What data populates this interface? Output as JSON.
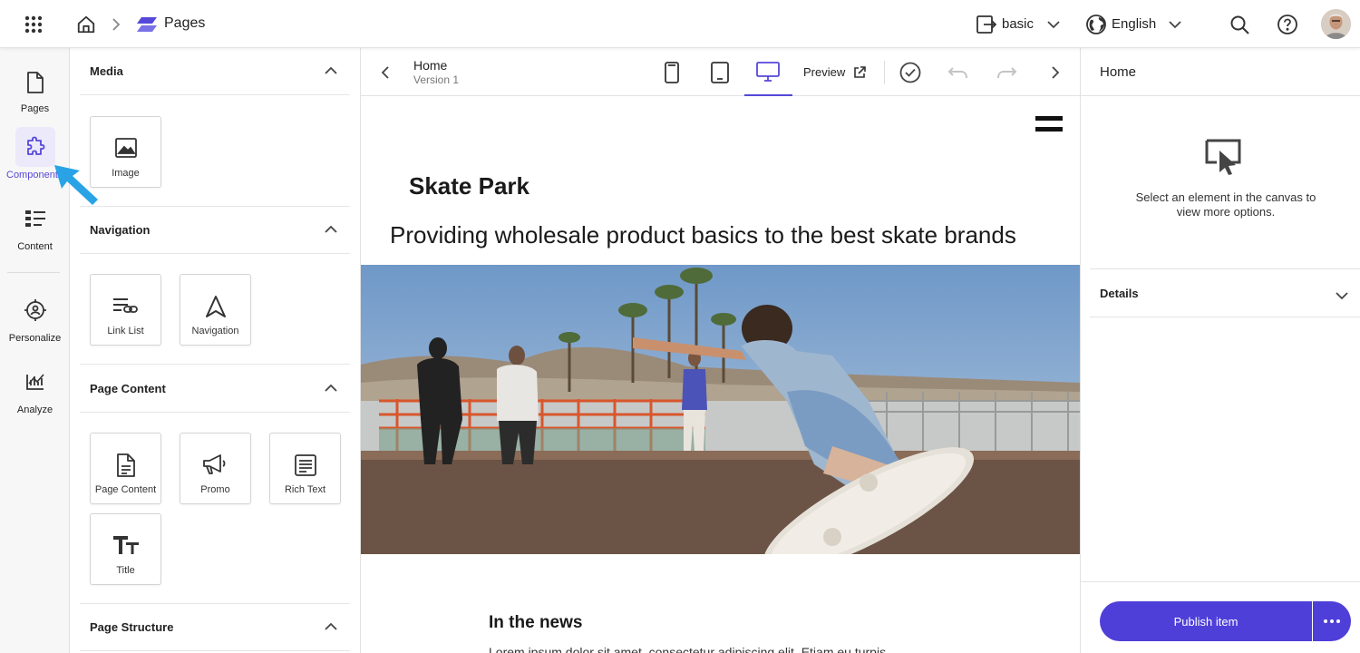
{
  "colors": {
    "accent": "#5548d9",
    "publish": "#4f3fd9",
    "arrow": "#29a3e6"
  },
  "topbar": {
    "apps_icon": "grid-icon",
    "home_icon": "home-icon",
    "breadcrumb_current": "Pages",
    "site_selector": "basic",
    "language_selector": "English",
    "search_icon": "search-icon",
    "help_icon": "help-icon"
  },
  "rail": {
    "items": [
      {
        "label": "Pages",
        "icon": "page-icon"
      },
      {
        "label": "Components",
        "icon": "puzzle-icon"
      },
      {
        "label": "Content",
        "icon": "content-list-icon"
      },
      {
        "label": "Personalize",
        "icon": "target-icon"
      },
      {
        "label": "Analyze",
        "icon": "analytics-icon"
      }
    ],
    "active": "Components"
  },
  "components": {
    "sections": [
      {
        "title": "Media",
        "tiles": [
          {
            "label": "Image",
            "icon": "image-icon"
          }
        ]
      },
      {
        "title": "Navigation",
        "tiles": [
          {
            "label": "Link List",
            "icon": "link-list-icon"
          },
          {
            "label": "Navigation",
            "icon": "navigation-icon"
          }
        ]
      },
      {
        "title": "Page Content",
        "tiles": [
          {
            "label": "Page Content",
            "icon": "document-icon"
          },
          {
            "label": "Promo",
            "icon": "megaphone-icon"
          },
          {
            "label": "Rich Text",
            "icon": "rich-text-icon"
          },
          {
            "label": "Title",
            "icon": "title-icon"
          }
        ]
      },
      {
        "title": "Page Structure",
        "tiles": []
      }
    ]
  },
  "canvas_toolbar": {
    "page_name": "Home",
    "version": "Version 1",
    "preview_label": "Preview"
  },
  "canvas": {
    "site_title": "Skate Park",
    "headline": "Providing wholesale product basics to the best skate brands",
    "news_heading": "In the news",
    "news_text": "Lorem ipsum dolor sit amet, consectetur adipiscing elit. Etiam eu turpis"
  },
  "right_panel": {
    "title": "Home",
    "empty_message": "Select an element in the canvas to view more options.",
    "details_label": "Details",
    "publish_label": "Publish item",
    "more_icon": "more-icon"
  }
}
